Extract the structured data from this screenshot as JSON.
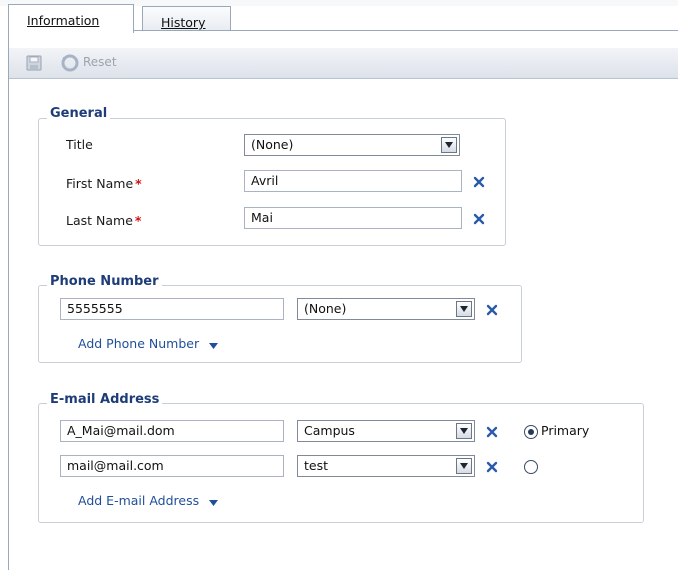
{
  "tabs": [
    {
      "label": "Information",
      "accesskey_index": 0,
      "active": true
    },
    {
      "label": "History",
      "accesskey_index": 0,
      "active": false
    }
  ],
  "toolbar": {
    "save_icon": "save-icon",
    "reset_label": "Reset",
    "reset_icon": "reset-icon"
  },
  "general": {
    "legend": "General",
    "title_label": "Title",
    "title_value": "(None)",
    "first_name_label": "First Name",
    "first_name_value": "Avril",
    "last_name_label": "Last Name",
    "last_name_value": "Mai",
    "required_marker": "*"
  },
  "phone": {
    "legend": "Phone Number",
    "numbers": [
      {
        "value": "5555555",
        "type": "(None)"
      }
    ],
    "add_label": "Add Phone Number"
  },
  "email": {
    "legend": "E-mail Address",
    "entries": [
      {
        "value": "A_Mai@mail.dom",
        "type": "Campus",
        "primary": true,
        "primary_label": "Primary"
      },
      {
        "value": "mail@mail.com",
        "type": "test",
        "primary": false,
        "primary_label": ""
      }
    ],
    "add_label": "Add E-mail Address"
  },
  "colors": {
    "legend_text": "#1e3d78",
    "link_text": "#1f4f9a",
    "required": "#d01212",
    "remove_x": "#2a5aa8"
  }
}
